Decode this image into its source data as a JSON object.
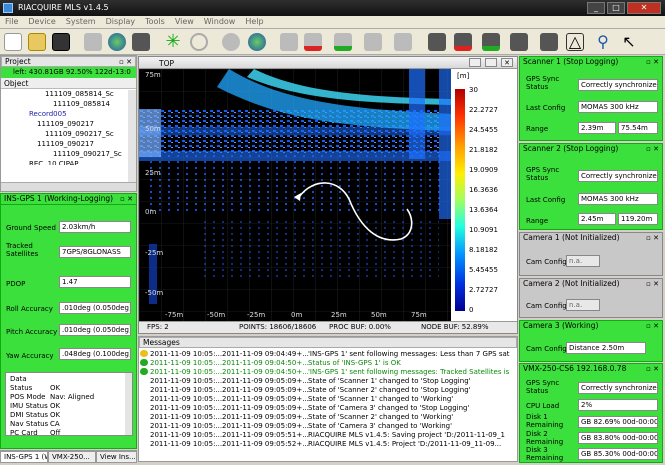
{
  "app": {
    "title": "RIACQUIRE MLS v1.4.5"
  },
  "menu": [
    "File",
    "Device",
    "System",
    "Display",
    "Tools",
    "View",
    "Window",
    "Help"
  ],
  "project": {
    "title": "Project",
    "status": "left: 430.81GB 92.50% 122d-13:0",
    "column": "Object",
    "items": [
      "111109_085814_Sc",
      "111109_085814",
      "Record005",
      "111109_090217",
      "111109_090217_Sc",
      "111109_090217",
      "111109_090217_Sc",
      "REC. 10 CIPAP"
    ]
  },
  "ins": {
    "title": "INS-GPS 1 (Working-Logging)",
    "rows": [
      {
        "label": "Ground Speed",
        "value": "2.03km/h"
      },
      {
        "label": "Tracked Satellites",
        "value": "7GPS/8GLONASS"
      },
      {
        "label": "PDOP",
        "value": "1.47"
      },
      {
        "label": "Roll Accuracy",
        "value": ".010deg (0.050deg)"
      },
      {
        "label": "Pitch Accuracy",
        "value": ".010deg (0.050deg)"
      },
      {
        "label": "Yaw Accuracy",
        "value": ".048deg (0.100deg)"
      }
    ],
    "status": [
      {
        "k": "Data Status",
        "v": "OK"
      },
      {
        "k": "POS Mode",
        "v": "Nav: Aligned"
      },
      {
        "k": "IMU Status",
        "v": "OK"
      },
      {
        "k": "DMI Status",
        "v": "OK"
      },
      {
        "k": "Nav Status",
        "v": "CA"
      },
      {
        "k": "PC Card",
        "v": "Off"
      }
    ]
  },
  "lefttabs": [
    "INS-GPS 1 (W...",
    "VMX-250...",
    "View Ins..."
  ],
  "view": {
    "title": "TOP",
    "fps": "FPS: 2",
    "points": "POINTS: 18606/18606",
    "proc": "PROC BUF: 0.00%",
    "node": "NODE BUF: 52.89%",
    "scale_unit": "[m]",
    "scale": [
      "30",
      "22.2727",
      "24.5455",
      "21.8182",
      "19.0909",
      "16.3636",
      "13.6364",
      "10.9091",
      "8.18182",
      "5.45455",
      "2.72727",
      "0"
    ],
    "yticks": [
      "75m",
      "50m",
      "25m",
      "0m",
      "-25m",
      "-50m"
    ],
    "xticks": [
      "-75m",
      "-50m",
      "-25m",
      "0m",
      "25m",
      "50m",
      "75m"
    ]
  },
  "messages": {
    "title": "Messages",
    "rows": [
      {
        "d": "2011-11-09 10:05:...",
        "t": "2011-11-09 09:04:49+...",
        "m": "'INS-GPS 1' sent following messages: Less than 7 GPS sat",
        "k": "warn"
      },
      {
        "d": "2011-11-09 10:05:...",
        "t": "2011-11-09 09:04:50+...",
        "m": "Status of 'INS-GPS 1' is OK",
        "k": "ok"
      },
      {
        "d": "2011-11-09 10:05:...",
        "t": "2011-11-09 09:04:50+...",
        "m": "'INS-GPS 1' sent following messages: Tracked Satellites is",
        "k": "ok"
      },
      {
        "d": "2011-11-09 10:05:...",
        "t": "2011-11-09 09:05:09+...",
        "m": "State of 'Scanner 1' changed to 'Stop Logging'",
        "k": "n"
      },
      {
        "d": "2011-11-09 10:05:...",
        "t": "2011-11-09 09:05:09+...",
        "m": "State of 'Scanner 2' changed to 'Stop Logging'",
        "k": "n"
      },
      {
        "d": "2011-11-09 10:05:...",
        "t": "2011-11-09 09:05:09+...",
        "m": "State of 'Scanner 1' changed to 'Working'",
        "k": "n"
      },
      {
        "d": "2011-11-09 10:05:...",
        "t": "2011-11-09 09:05:09+...",
        "m": "State of 'Camera 3' changed to 'Stop Logging'",
        "k": "n"
      },
      {
        "d": "2011-11-09 10:05:...",
        "t": "2011-11-09 09:05:09+...",
        "m": "State of 'Scanner 2' changed to 'Working'",
        "k": "n"
      },
      {
        "d": "2011-11-09 10:05:...",
        "t": "2011-11-09 09:05:09+...",
        "m": "State of 'Camera 3' changed to 'Working'",
        "k": "n"
      },
      {
        "d": "2011-11-09 10:05:...",
        "t": "2011-11-09 09:05:51+...",
        "m": "RIACQUIRE MLS v1.4.5: Saving project 'D:/2011-11-09_1",
        "k": "n"
      },
      {
        "d": "2011-11-09 10:05:...",
        "t": "2011-11-09 09:05:52+...",
        "m": "RIACQUIRE MLS v1.4.5: Project 'D:/2011-11-09_11-09...",
        "k": "n"
      }
    ]
  },
  "scanner1": {
    "title": "Scanner 1 (Stop Logging)",
    "gps_label": "GPS Sync Status",
    "gps": "Correctly synchronized",
    "cfg_label": "Last Config",
    "cfg": "MOMAS 300 kHz",
    "range_label": "Range",
    "r1": "2.39m",
    "r2": "75.54m"
  },
  "scanner2": {
    "title": "Scanner 2 (Stop Logging)",
    "gps_label": "GPS Sync Status",
    "gps": "Correctly synchronized",
    "cfg_label": "Last Config",
    "cfg": "MOMAS 300 kHz",
    "range_label": "Range",
    "r1": "2.45m",
    "r2": "119.20m"
  },
  "camera1": {
    "title": "Camera 1 (Not Initialized)",
    "label": "Cam Config",
    "value": "n.a."
  },
  "camera2": {
    "title": "Camera 2 (Not Initialized)",
    "label": "Cam Config",
    "value": "n.a."
  },
  "camera3": {
    "title": "Camera 3 (Working)",
    "label": "Cam Config",
    "value": "Distance 2.50m"
  },
  "vmx": {
    "title": "VMX-250-CS6 192.168.0.78",
    "gps_label": "GPS Sync Status",
    "gps": "Correctly synchronized",
    "cpu_label": "CPU Load",
    "cpu": "2%",
    "disks": [
      {
        "label": "Disk 1 Remaining",
        "value": "GB 82.69% 00d-00:00"
      },
      {
        "label": "Disk 2 Remaining",
        "value": "GB 83.80% 00d-00:00"
      },
      {
        "label": "Disk 3 Remaining",
        "value": "GB 85.30% 00d-00:00"
      }
    ]
  },
  "colors": {
    "status_green": "#3ce03c",
    "view_bg": "#000000",
    "accent": "#1e4fd8"
  }
}
